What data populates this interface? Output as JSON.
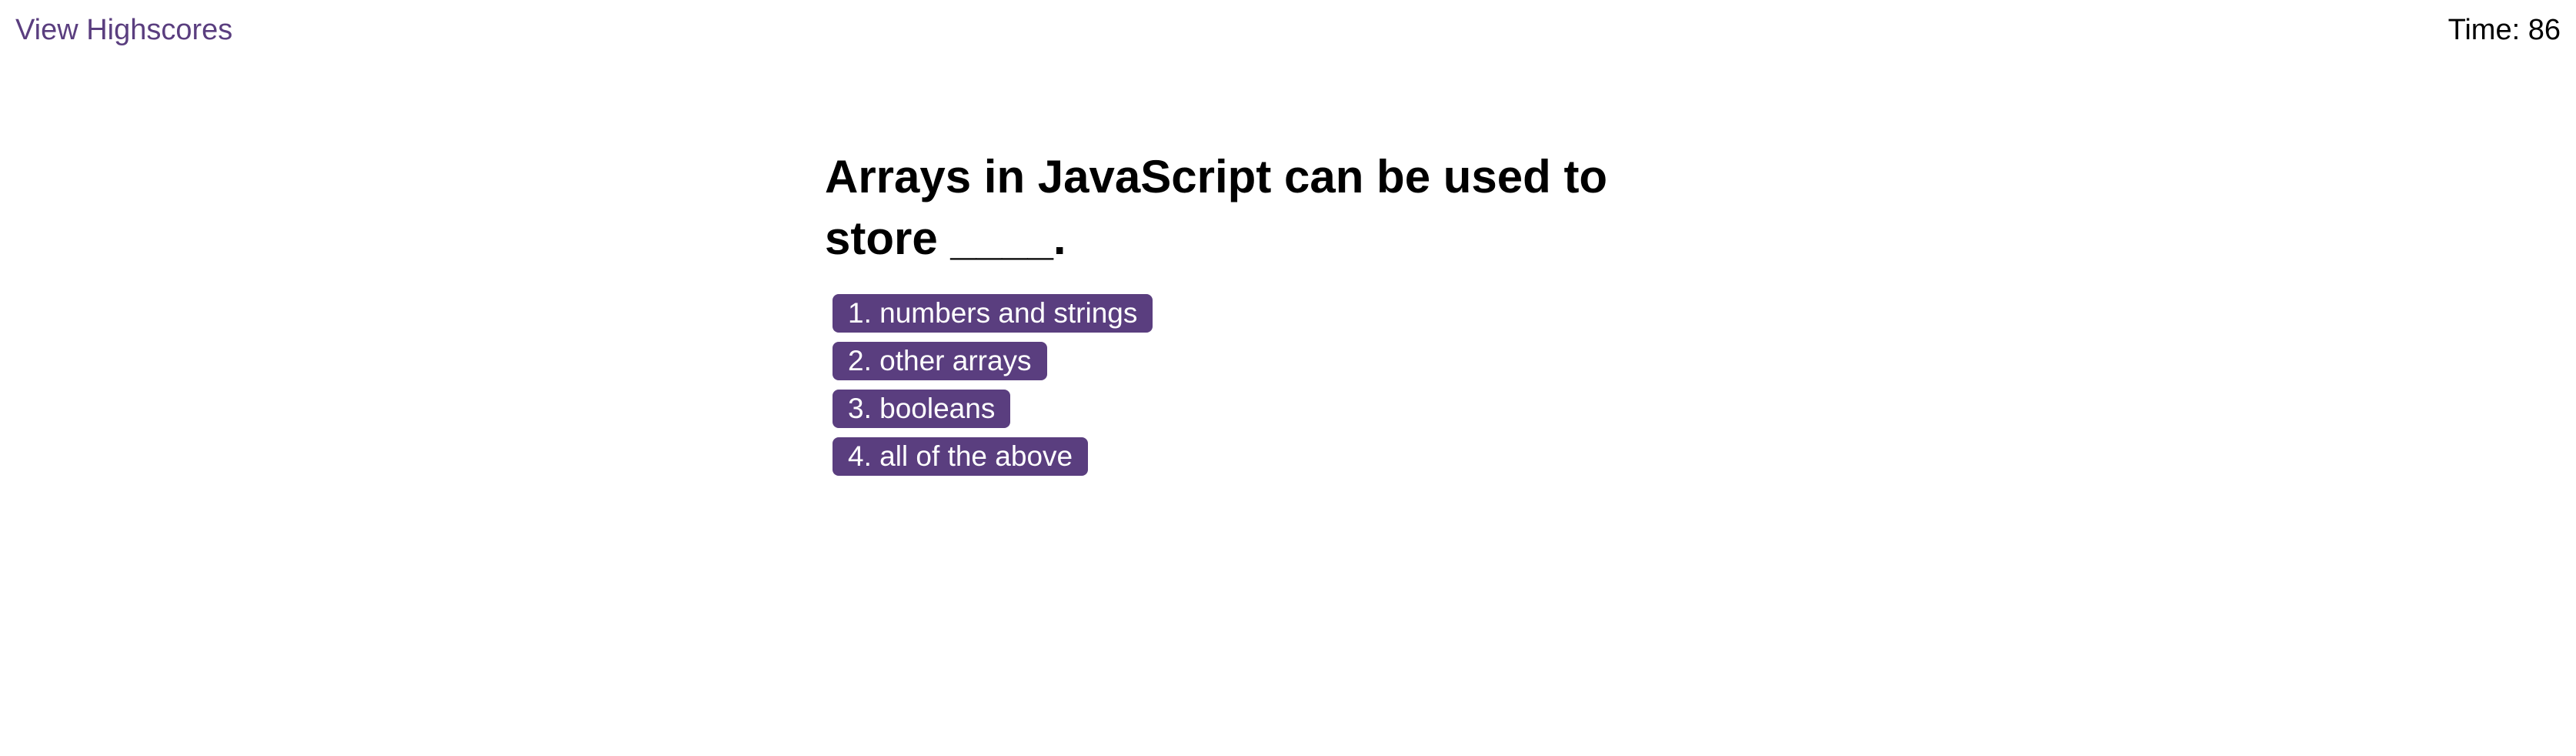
{
  "header": {
    "highscores_link": "View Highscores",
    "timer_label": "Time:",
    "timer_value": "86"
  },
  "quiz": {
    "question": "Arrays in JavaScript can be used to store ____.",
    "choices": [
      "1. numbers and strings",
      "2. other arrays",
      "3. booleans",
      "4. all of the above"
    ]
  },
  "colors": {
    "accent": "#5a3e7f",
    "button_text": "#ffffff"
  }
}
